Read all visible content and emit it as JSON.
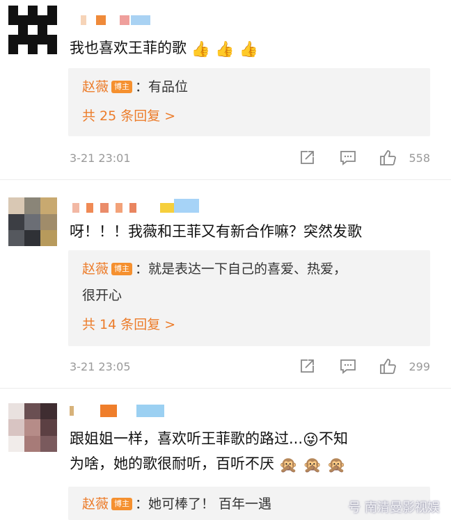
{
  "comments": [
    {
      "text": "我也喜欢王菲的歌",
      "emojis": "👍 👍 👍",
      "reply": {
        "author": "赵薇",
        "badge": "博主",
        "text": "：有品位",
        "more": "共 25 条回复 >"
      },
      "time": "3-21 23:01",
      "likes": "558"
    },
    {
      "text": "呀！！！我薇和王菲又有新合作嘛？突然发歌",
      "emojis": "",
      "reply": {
        "author": "赵薇",
        "badge": "博主",
        "text_line1": "：就是表达一下自己的喜爱、热爱，",
        "text_line2": "很开心",
        "more": "共 14 条回复 >"
      },
      "time": "3-21 23:05",
      "likes": "299"
    },
    {
      "text_line1": "跟姐姐一样，喜欢听王菲歌的路过...",
      "emoji_inline": "😜",
      "text_line1b": "不知",
      "text_line2": "为啥，她的歌很耐听，百听不厌",
      "emojis_line2": "🙊 🙊 🙊",
      "reply": {
        "author": "赵薇",
        "badge": "博主",
        "text": "：她可棒了！ 百年一遇"
      }
    }
  ],
  "watermark": "号 南清曼影视娱",
  "colors": {
    "accent": "#ec7c2a",
    "badge": "#f5902f",
    "reply_bg": "#f3f3f3"
  },
  "icons": [
    "share-icon",
    "comment-icon",
    "like-icon"
  ]
}
